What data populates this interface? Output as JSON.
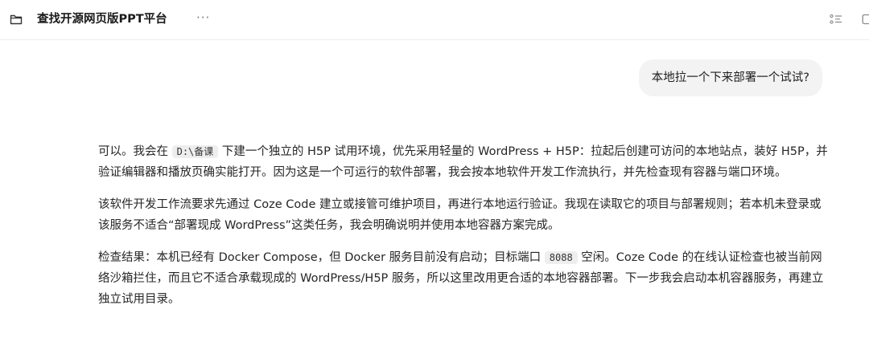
{
  "header": {
    "title": "查找开源网页版PPT平台",
    "more_label": "···"
  },
  "icons": {
    "title_icon": "folder-icon",
    "right_icon_1": "list-icon",
    "right_icon_2": "panel-icon"
  },
  "conversation": {
    "user_message": "本地拉一个下来部署一个试试?",
    "assistant": {
      "p1": {
        "part1": "可以。我会在 ",
        "code": "D:\\备课",
        "part2": " 下建一个独立的 H5P 试用环境，优先采用轻量的 WordPress + H5P：拉起后创建可访问的本地站点，装好 H5P，并验证编辑器和播放页确实能打开。因为这是一个可运行的软件部署，我会按本地软件开发工作流执行，并先检查现有容器与端口环境。"
      },
      "p2": "该软件开发工作流要求先通过 Coze Code 建立或接管可维护项目，再进行本地运行验证。我现在读取它的项目与部署规则；若本机未登录或该服务不适合“部署现成 WordPress”这类任务，我会明确说明并使用本地容器方案完成。",
      "p3": {
        "part1": "检查结果：本机已经有 Docker Compose，但 Docker 服务目前没有启动；目标端口 ",
        "code": "8088",
        "part2": " 空闲。Coze Code 的在线认证检查也被当前网络沙箱拦住，而且它不适合承载现成的 WordPress/H5P 服务，所以这里改用更合适的本地容器部署。下一步我会启动本机容器服务，再建立独立试用目录。"
      }
    }
  }
}
